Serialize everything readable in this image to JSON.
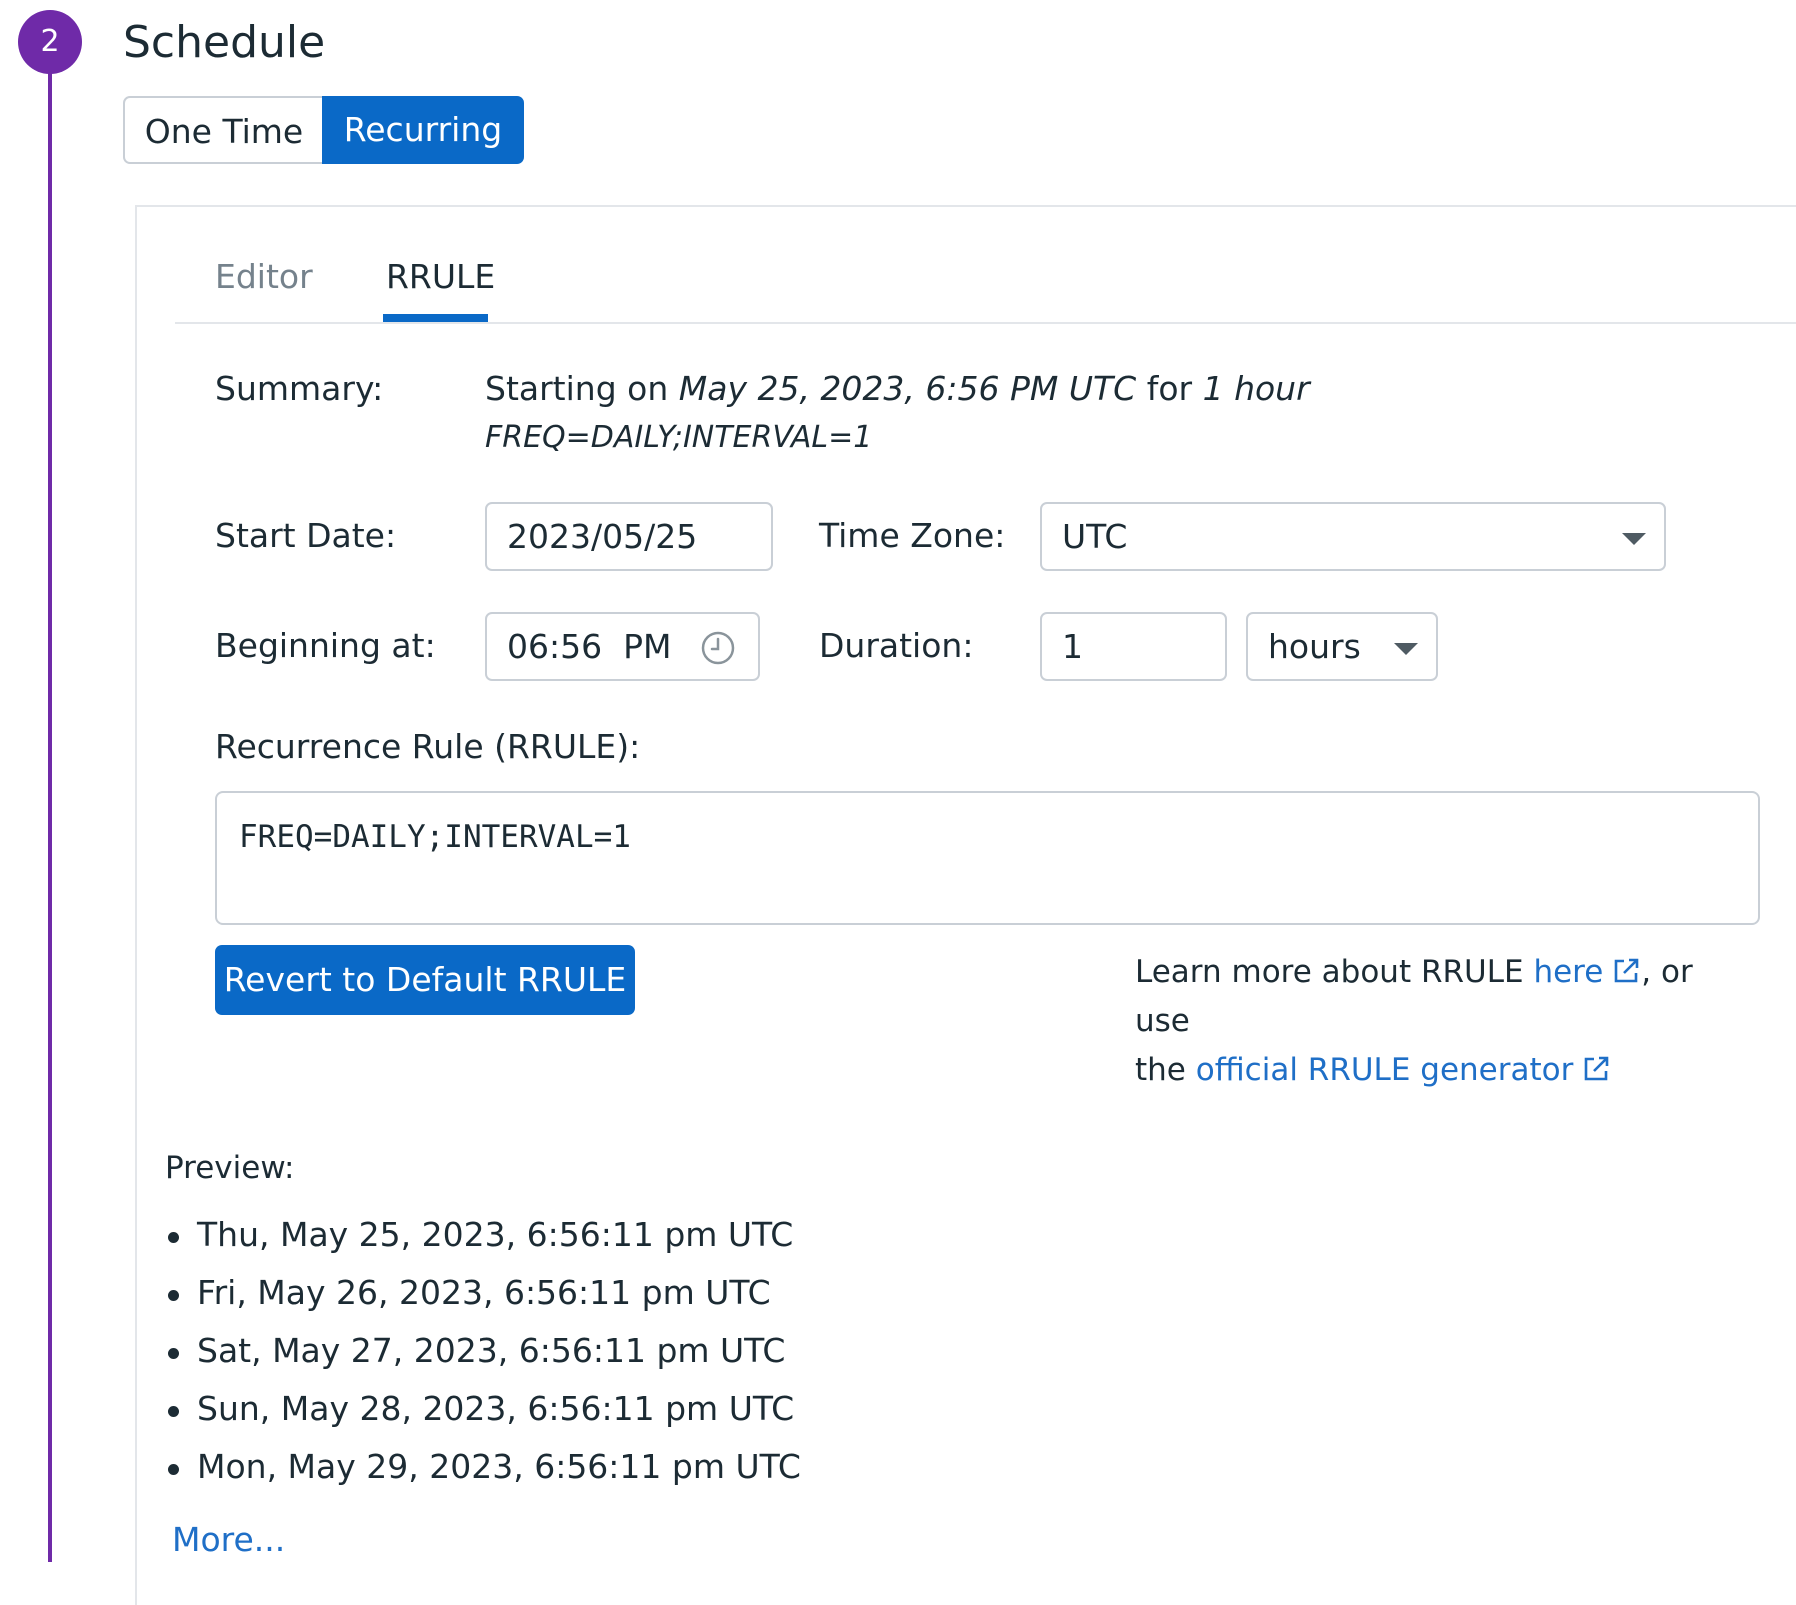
{
  "colors": {
    "step_purple": "#6f2aa8",
    "primary_blue": "#0a69c7",
    "link_blue": "#1f6fc7",
    "text": "#1c2b34",
    "muted": "#75828c",
    "border": "#c9cfd6"
  },
  "step": {
    "number": "2",
    "title": "Schedule"
  },
  "schedule_type": {
    "options": [
      "One Time",
      "Recurring"
    ],
    "selected": "Recurring"
  },
  "tabs": {
    "items": [
      {
        "label": "Editor"
      },
      {
        "label": "RRULE"
      }
    ],
    "active": "RRULE"
  },
  "summary": {
    "label": "Summary:",
    "prefix": "Starting on",
    "start": "May 25, 2023, 6:56 PM UTC",
    "for_word": "for",
    "duration": "1 hour",
    "rule": "FREQ=DAILY;INTERVAL=1"
  },
  "start_date": {
    "label": "Start Date:",
    "value": "2023/05/25"
  },
  "time_zone": {
    "label": "Time Zone:",
    "value": "UTC",
    "icon": "chevron-down-icon"
  },
  "beginning_at": {
    "label": "Beginning at:",
    "value": "06:56  PM",
    "icon": "clock-icon"
  },
  "duration": {
    "label": "Duration:",
    "value": "1",
    "unit": "hours",
    "icon": "chevron-down-icon"
  },
  "rrule": {
    "label": "Recurrence Rule (RRULE):",
    "value": "FREQ=DAILY;INTERVAL=1"
  },
  "revert_button": {
    "label": "Revert to Default RRULE"
  },
  "learn_more": {
    "text_1": "Learn more about RRULE ",
    "link_1": "here",
    "text_2": ", or use",
    "text_3": "the ",
    "link_2": "official RRULE generator",
    "icon": "external-link-icon"
  },
  "preview": {
    "label": "Preview:",
    "items": [
      "Thu, May 25, 2023, 6:56:11 pm UTC",
      "Fri, May 26, 2023, 6:56:11 pm UTC",
      "Sat, May 27, 2023, 6:56:11 pm UTC",
      "Sun, May 28, 2023, 6:56:11 pm UTC",
      "Mon, May 29, 2023, 6:56:11 pm UTC"
    ],
    "more_link": "More..."
  }
}
